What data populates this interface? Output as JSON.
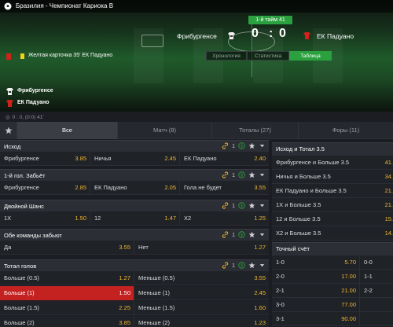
{
  "hero": {
    "league": "Бразилия - Чемпионат Кариока B",
    "period": "1-й тайм 41",
    "home_team": "Фрибургенсе",
    "away_team": "ЕК Падуано",
    "home_score": "0",
    "away_score": "0",
    "score_separator": ":",
    "last_event": "Желтая карточка 35' ЕК Падуано",
    "view_tabs": [
      "Хронология",
      "Статистика",
      "Таблица"
    ],
    "active_view_tab": "Таблица",
    "lineups": [
      "Фрибургенсе",
      "ЕК Падуано"
    ],
    "mini_score": "0 : 0, (0:0) 41'"
  },
  "filters": {
    "tabs": [
      {
        "label": "Все",
        "active": true
      },
      {
        "label": "Матч (8)",
        "active": false
      },
      {
        "label": "Тоталы (27)",
        "active": false
      },
      {
        "label": "Форы (11)",
        "active": false
      }
    ]
  },
  "left_markets": [
    {
      "title": "Исход",
      "count": "1",
      "rows": [
        [
          {
            "label": "Фрибургенсе",
            "odd": "3.85"
          },
          {
            "label": "Ничья",
            "odd": "2.45"
          },
          {
            "label": "ЕК Падуано",
            "odd": "2.40"
          }
        ]
      ]
    },
    {
      "title": "1-й гол. Забьёт",
      "count": "1",
      "rows": [
        [
          {
            "label": "Фрибургенсе",
            "odd": "2.85"
          },
          {
            "label": "ЕК Падуано",
            "odd": "2.05"
          },
          {
            "label": "Гола не будет",
            "odd": "3.55"
          }
        ]
      ]
    },
    {
      "title": "Двойной Шанс",
      "count": "1",
      "rows": [
        [
          {
            "label": "1X",
            "odd": "1.50"
          },
          {
            "label": "12",
            "odd": "1.47"
          },
          {
            "label": "X2",
            "odd": "1.25"
          }
        ]
      ]
    },
    {
      "title": "Обе команды забьют",
      "count": "1",
      "rows": [
        [
          {
            "label": "Да",
            "odd": "3.55"
          },
          {
            "label": "Нет",
            "odd": "1.27"
          }
        ]
      ]
    },
    {
      "title": "Тотал голов",
      "count": "1",
      "rows": [
        [
          {
            "label": "Больше (0.5)",
            "odd": "1.27"
          },
          {
            "label": "Меньше (0.5)",
            "odd": "3.55"
          }
        ],
        [
          {
            "label": "Больше (1)",
            "odd": "1.50",
            "selected": true
          },
          {
            "label": "Меньше (1)",
            "odd": "2.45"
          }
        ],
        [
          {
            "label": "Больше (1.5)",
            "odd": "2.25"
          },
          {
            "label": "Меньше (1.5)",
            "odd": "1.60"
          }
        ],
        [
          {
            "label": "Больше (2)",
            "odd": "3.85"
          },
          {
            "label": "Меньше (2)",
            "odd": "1.23"
          }
        ]
      ]
    }
  ],
  "right_markets": [
    {
      "title": "Исход и Тотал 3.5",
      "rows": [
        {
          "label": "Фрибургенсе и Больше 3.5",
          "odd": "41."
        },
        {
          "label": "Ничья и Больше 3.5",
          "odd": "34."
        },
        {
          "label": "ЕК Падуано и Больше 3.5",
          "odd": "21."
        },
        {
          "label": "1X и Больше 3.5",
          "odd": "21."
        },
        {
          "label": "12 и Больше 3.5",
          "odd": "15."
        },
        {
          "label": "X2 и Больше 3.5",
          "odd": "14."
        }
      ]
    },
    {
      "title": "Точный счёт",
      "rows": [
        [
          {
            "label": "1-0",
            "odd": "5.70"
          },
          {
            "label": "0-0",
            "odd": ""
          }
        ],
        [
          {
            "label": "2-0",
            "odd": "17.00"
          },
          {
            "label": "1-1",
            "odd": ""
          }
        ],
        [
          {
            "label": "2-1",
            "odd": "21.00"
          },
          {
            "label": "2-2",
            "odd": ""
          }
        ],
        [
          {
            "label": "3-0",
            "odd": "77.00"
          },
          {
            "label": "",
            "odd": ""
          }
        ],
        [
          {
            "label": "3-1",
            "odd": "90.00"
          },
          {
            "label": "",
            "odd": ""
          }
        ]
      ]
    }
  ],
  "colors": {
    "accent_green": "#2aa03f",
    "odds": "#f0b531",
    "selected": "#c42121",
    "home_kit": "#f2f2f2",
    "away_kit": "#d0211b"
  },
  "icons": [
    "soccer-ball-icon",
    "star-icon",
    "link-icon",
    "dollar-icon",
    "chevron-down-icon",
    "jersey-icon"
  ]
}
